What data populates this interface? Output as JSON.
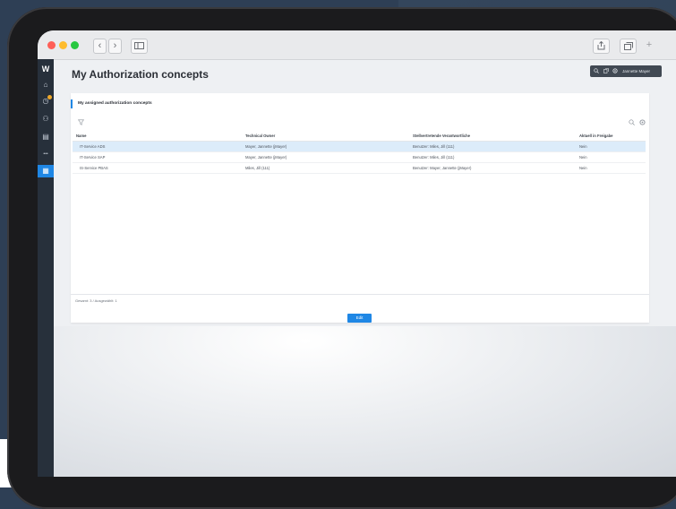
{
  "browser": {
    "back_icon": "chevron-left-icon",
    "forward_icon": "chevron-right-icon",
    "sidebar_icon": "sidebar-icon",
    "share_icon": "share-icon",
    "tabs_icon": "tabs-icon",
    "newtab_icon": "plus-icon"
  },
  "sidebar": {
    "logo": "W",
    "items": [
      {
        "icon": "home-icon",
        "glyph": "⌂"
      },
      {
        "icon": "history-icon",
        "glyph": "◷",
        "badge": true
      },
      {
        "icon": "users-icon",
        "glyph": "⚇"
      },
      {
        "icon": "document-icon",
        "glyph": "▤"
      },
      {
        "icon": "more-icon",
        "glyph": "•••"
      },
      {
        "icon": "calendar-icon",
        "glyph": "▦",
        "active": true
      }
    ]
  },
  "header": {
    "title": "My Authorization concepts",
    "user_name": "Jannette Mayer"
  },
  "card": {
    "section_title": "My assigned authorization concepts",
    "filter_icon": "filter-icon",
    "search_icon": "search-icon",
    "settings_icon": "gear-icon",
    "columns": [
      "Name",
      "Technical Owner",
      "Stellvertretende Verantwortliche",
      "Aktuell in Freigabe"
    ],
    "rows": [
      {
        "name": "IT-Service ADS",
        "owner": "Mayer, Jannette (jMayer)",
        "deputy": "Benutzer: Miles, Jill (111)",
        "status": "Nein",
        "selected": true
      },
      {
        "name": "IT-Service SAP",
        "owner": "Mayer, Jannette (jMayer)",
        "deputy": "Benutzer: Miles, Jill (111)",
        "status": "Nein",
        "selected": false
      },
      {
        "name": "IS-Service PBAS",
        "owner": "Miles, Jill (111)",
        "deputy": "Benutzer: Mayer, Jannette (jMayer)",
        "status": "Nein",
        "selected": false
      }
    ],
    "footer": "Gesamt: 3 / Ausgewählt: 1",
    "edit_label": "Edit"
  },
  "colors": {
    "accent": "#1f87e5",
    "sidebar_bg": "#27303b",
    "selected_row": "#dcecfa"
  }
}
